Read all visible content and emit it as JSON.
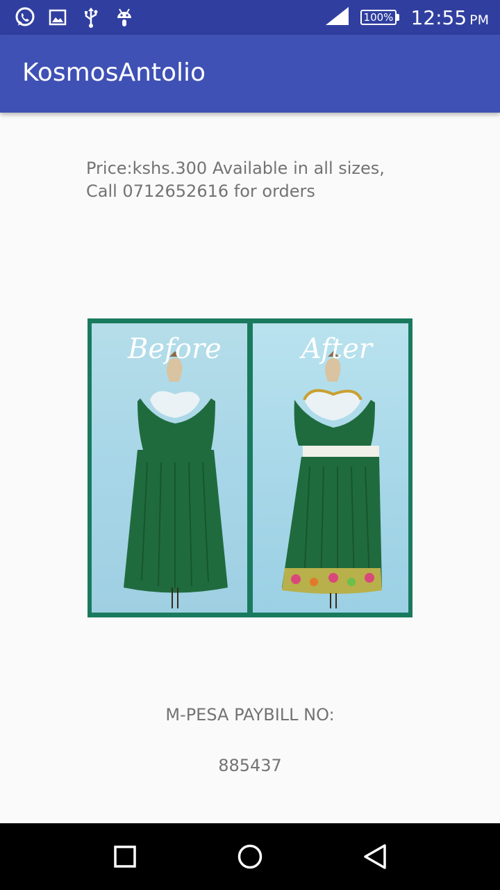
{
  "status_bar": {
    "left_icons": [
      "whatsapp-icon",
      "image-icon",
      "usb-icon",
      "android-icon"
    ],
    "battery": "100%",
    "time": "12:55",
    "ampm": "PM"
  },
  "app_bar": {
    "title": "KosmosAntolio"
  },
  "content": {
    "description": "Price:kshs.300 Available in all sizes, Call 0712652616 for orders",
    "image": {
      "before_label": "Before",
      "after_label": "After"
    },
    "mpesa_label": "M-PESA PAYBILL NO:",
    "mpesa_number": "885437"
  },
  "nav_bar": {
    "buttons": [
      "square-icon",
      "circle-icon",
      "triangle-icon"
    ]
  },
  "colors": {
    "status_bar": "#303f9f",
    "app_bar": "#3f51b5",
    "text": "#737373",
    "dress_green": "#1f6b3e",
    "frame": "#1a7a5e"
  }
}
